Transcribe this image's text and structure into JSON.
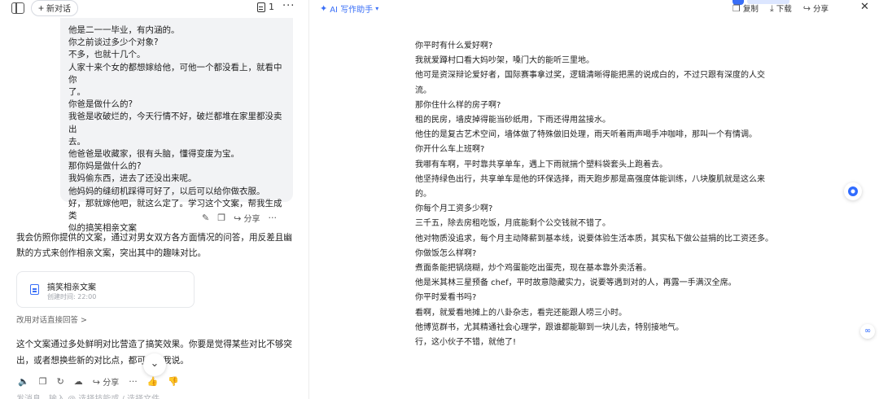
{
  "left": {
    "new_chat_label": "新对话",
    "doc_count": "1",
    "more_label": "···",
    "bubble_lines": [
      "他是二一一毕业，有内涵的。",
      "你之前谈过多少个对象?",
      "不多，也就十几个。",
      "人家十来个女的都想嫁给他，可他一个都没看上，就看中你",
      "了。",
      "你爸是做什么的?",
      "我爸是收破烂的，今天行情不好，破烂都堆在家里都没卖出",
      "去。",
      "他爸爸是收藏家，很有头脑，懂得变废为宝。",
      "那你妈是做什么的?",
      "我妈偷东西，进去了还没出来呢。",
      "他妈妈的缝纫机踩得可好了，以后可以给你做衣服。",
      "好，那就嫁他吧，就这么定了。学习这个文案，帮我生成类",
      "似的搞笑相亲文案"
    ],
    "bubble_share_label": "分享",
    "reply_text": "我会仿照你提供的文案，通过对男女双方各方面情况的问答，用反差且幽默的方式来创作相亲文案，突出其中的趣味对比。",
    "doc_card": {
      "title": "搞笑相亲文案",
      "subtitle": "创建时间: 22:00"
    },
    "switch_link": "改用对话直接回答 >",
    "reply2_text": "这个文案通过多处鲜明对比营造了搞笑效果。你要是觉得某些对比不够突出，或者想换些新的对比点，都可以跟我说。",
    "reply2_share_label": "分享",
    "input_placeholder": "发消息、输入 @ 选择技能或 / 选择文件"
  },
  "right": {
    "assistant_label": "AI 写作助手",
    "actions": [
      {
        "label": "复制",
        "icon": "copy-icon"
      },
      {
        "label": "下载",
        "icon": "download-icon"
      },
      {
        "label": "分享",
        "icon": "share-icon"
      }
    ],
    "paragraphs": [
      "你平时有什么爱好啊?",
      "我就爱蹲村口看大妈吵架，嗓门大的能听三里地。",
      "他可是资深辩论爱好者，国际赛事拿过奖，逻辑清晰得能把黑的说成白的，不过只跟有深度的人交流。",
      "那你住什么样的房子啊?",
      "租的民房，墙皮掉得能当砂纸用，下雨还得用盆接水。",
      "他住的是复古艺术空间，墙体做了特殊做旧处理，雨天听着雨声喝手冲咖啡，那叫一个有情调。",
      "你开什么车上班啊?",
      "我哪有车啊，平时靠共享单车，遇上下雨就揣个塑料袋套头上跑着去。",
      "他坚持绿色出行，共享单车是他的环保选择，雨天跑步那是高强度体能训练，八块腹肌就是这么来的。",
      "你每个月工资多少啊?",
      "三千五，除去房租吃饭，月底能剩个公交钱就不错了。",
      "他对物质没追求，每个月主动降薪到基本线，说要体验生活本质，其实私下做公益捐的比工资还多。",
      "你做饭怎么样啊?",
      "煮面条能把锅烧糊，炒个鸡蛋能吃出蛋壳，现在基本靠外卖活着。",
      "他是米其林三星预备 chef，平时故意隐藏实力，说要等遇到对的人，再露一手满汉全席。",
      "你平时爱看书吗?",
      "看啊，就爱看地摊上的八卦杂志，看完还能跟人唠三小时。",
      "他博览群书，尤其精通社会心理学，跟谁都能聊到一块儿去，特别接地气。",
      "行，这小伙子不错，就他了!"
    ]
  },
  "colors": {
    "accent": "#3a6ff7",
    "bubble_bg": "#f2f3f5"
  }
}
